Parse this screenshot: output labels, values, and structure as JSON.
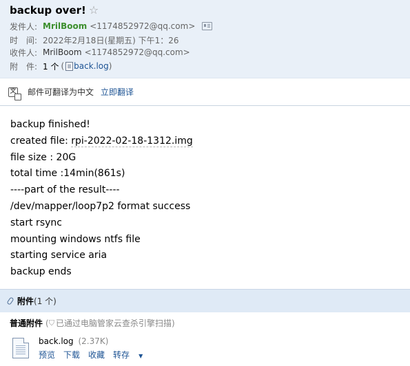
{
  "email": {
    "subject": "backup over!",
    "from_label": "发件人:",
    "from_name": "MrilBoom",
    "from_email": "<1174852972@qq.com>",
    "time_label": "时　间:",
    "time_value": "2022年2月18日(星期五) 下午1：26",
    "to_label": "收件人:",
    "to_name": "MrilBoom",
    "to_email": "<1174852972@qq.com>",
    "att_label": "附　件:",
    "att_count": "1 个",
    "att_open_paren": "(",
    "att_file": "back.log",
    "att_close_paren": ")"
  },
  "translate": {
    "prompt": "邮件可翻译为中文",
    "link": "立即翻译"
  },
  "body": {
    "line1": "backup finished!",
    "line2_prefix": "created file: ",
    "line2_file": "rpi-2022-02-18-1312.img",
    "line3": "file size : 20G",
    "line4": "total time :14min(861s)",
    "line5": "----part of the result----",
    "line6": "/dev/mapper/loop7p2 format success",
    "line7": "start rsync",
    "line8": "mounting windows ntfs file",
    "line9": "starting service aria",
    "line10": "backup ends"
  },
  "attachments": {
    "title": "附件",
    "count": "(1 个)",
    "section_title": "普通附件",
    "scan_open": "(",
    "scan_note": "已通过电脑管家云查杀引擎扫描",
    "scan_close": ")",
    "file_name": "back.log",
    "file_size": "(2.37K)",
    "actions": {
      "preview": "预览",
      "download": "下载",
      "save": "收藏",
      "forward": "转存"
    }
  }
}
